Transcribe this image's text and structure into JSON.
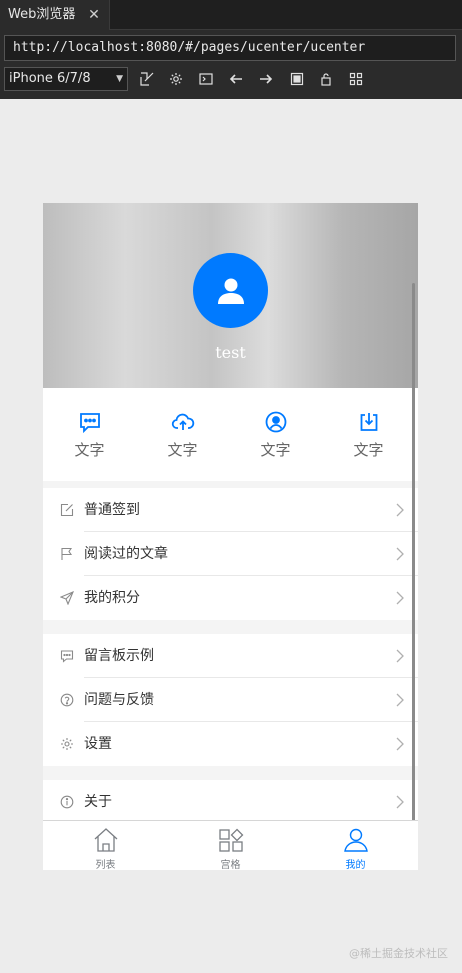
{
  "ide": {
    "tab_title": "Web浏览器",
    "tab_close": "✕",
    "url": "http://localhost:8080/#/pages/ucenter/ucenter",
    "device_select": "iPhone 6/7/8"
  },
  "profile": {
    "username": "test"
  },
  "quick_actions": [
    {
      "icon": "chat-bubble-icon",
      "label": "文字"
    },
    {
      "icon": "cloud-upload-icon",
      "label": "文字"
    },
    {
      "icon": "person-circle-icon",
      "label": "文字"
    },
    {
      "icon": "download-box-icon",
      "label": "文字"
    }
  ],
  "menu_groups": [
    [
      {
        "icon": "edit-icon",
        "label": "普通签到"
      },
      {
        "icon": "flag-icon",
        "label": "阅读过的文章"
      },
      {
        "icon": "send-icon",
        "label": "我的积分"
      }
    ],
    [
      {
        "icon": "message-icon",
        "label": "留言板示例"
      },
      {
        "icon": "help-icon",
        "label": "问题与反馈"
      },
      {
        "icon": "settings-icon",
        "label": "设置"
      }
    ],
    [
      {
        "icon": "info-icon",
        "label": "关于"
      }
    ]
  ],
  "bottom_tabs": [
    {
      "icon": "home-icon",
      "label": "列表",
      "active": false
    },
    {
      "icon": "grid-icon",
      "label": "宫格",
      "active": false
    },
    {
      "icon": "person-icon",
      "label": "我的",
      "active": true
    }
  ],
  "colors": {
    "accent": "#007aff",
    "text": "#333333",
    "muted": "#7a7e83"
  },
  "watermark": "@稀土掘金技术社区"
}
